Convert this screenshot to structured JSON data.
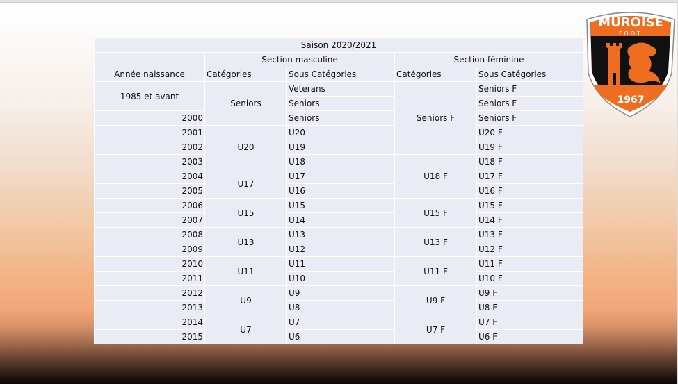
{
  "title": "Saison 2020/2021",
  "headers": {
    "birth_year": "Année naissance",
    "male_section": "Section masculine",
    "female_section": "Section féminine",
    "categories": "Catégories",
    "sub_categories": "Sous Catégories"
  },
  "years": [
    "1985 et avant",
    "2000",
    "2001",
    "2002",
    "2003",
    "2004",
    "2005",
    "2006",
    "2007",
    "2008",
    "2009",
    "2010",
    "2011",
    "2012",
    "2013",
    "2014",
    "2015"
  ],
  "male_categories": [
    "Seniors",
    "U20",
    "U17",
    "U15",
    "U13",
    "U11",
    "U9",
    "U7"
  ],
  "male_sub": [
    "Veterans",
    "Seniors",
    "Seniors",
    "U20",
    "U19",
    "U18",
    "U17",
    "U16",
    "U15",
    "U14",
    "U13",
    "U12",
    "U11",
    "U10",
    "U9",
    "U8",
    "U7",
    "U6"
  ],
  "female_categories": [
    "Seniors F",
    "U18 F",
    "U15 F",
    "U13 F",
    "U11 F",
    "U9 F",
    "U7 F"
  ],
  "female_sub": [
    "Seniors F",
    "Seniors F",
    "Seniors F",
    "U20 F",
    "U19 F",
    "U18 F",
    "U17 F",
    "U16 F",
    "U15 F",
    "U14 F",
    "U13 F",
    "U12 F",
    "U11 F",
    "U10 F",
    "U9 F",
    "U8 F",
    "U7 F",
    "U6 F"
  ],
  "logo": {
    "name": "MUROISE",
    "sub": "FOOT",
    "year": "1967"
  },
  "colors": {
    "table_bg": "#e9ebf5",
    "logo_orange": "#ef6d1f",
    "logo_black": "#111111"
  }
}
